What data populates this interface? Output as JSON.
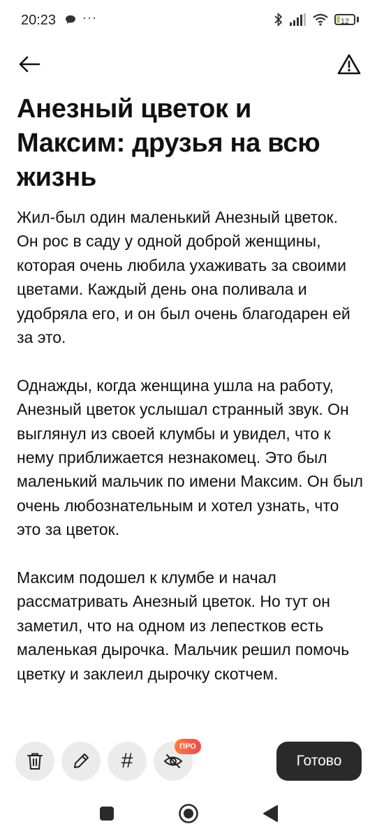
{
  "status_bar": {
    "time": "20:23",
    "dots": "···",
    "battery": "12"
  },
  "header": {
    "back_icon": "arrow-left-icon",
    "report_icon": "warning-triangle-icon"
  },
  "story": {
    "title": "Анезный цветок и Максим: друзья на всю жизнь",
    "paragraphs": [
      "Жил-был один маленький Анезный цветок. Он рос в саду у одной доброй женщины, которая очень любила ухаживать за своими цветами. Каждый день она поливала и удобряла его, и он был очень благодарен ей за это.",
      "Однажды, когда женщина ушла на работу, Анезный цветок услышал странный звук. Он выглянул из своей клумбы и увидел, что к нему приближается незнакомец. Это был маленький мальчик по имени Максим. Он был очень любознательным и хотел узнать, что это за цветок.",
      "Максим подошел к клумбе и начал рассматривать Анезный цветок. Но тут он заметил, что на одном из лепестков есть маленькая дырочка. Мальчик решил помочь цветку и заклеил дырочку скотчем."
    ]
  },
  "toolbar": {
    "pro_badge": "ПРО",
    "hash_label": "#",
    "done_label": "Готово"
  },
  "colors": {
    "accent_dark": "#2a2a2a",
    "button_bg": "#ebebeb",
    "pro_badge": "#f25a3f"
  }
}
